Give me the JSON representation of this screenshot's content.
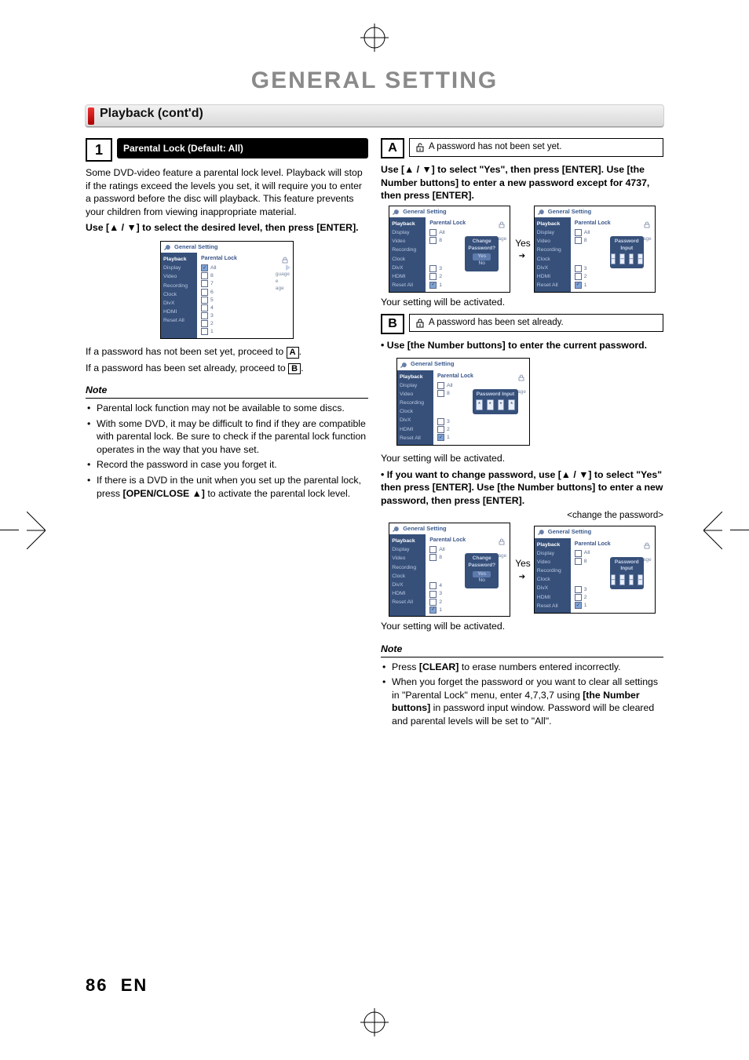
{
  "title": "GENERAL SETTING",
  "section": "Playback (cont'd)",
  "step1": {
    "num": "1",
    "heading": "Parental Lock (Default: All)",
    "para": "Some DVD-video feature a parental lock level. Playback will stop if the ratings exceed the levels you set, it will require you to enter a password before the disc will playback. This feature prevents your children from viewing inappropriate material.",
    "instr_pre": "Use [",
    "instr_mid": " / ",
    "instr_post": "] to select the desired level, then press [ENTER]."
  },
  "osd": {
    "title": "General Setting",
    "side": [
      "Playback",
      "Display",
      "Video",
      "Recording",
      "Clock",
      "DivX",
      "HDMI",
      "Reset All"
    ],
    "parental_label": "Parental Lock",
    "levels": [
      "All",
      "8",
      "7",
      "6",
      "5",
      "4",
      "3",
      "2",
      "1"
    ],
    "levels_short_top": [
      "All",
      "8"
    ],
    "levels_short_bottom": [
      "4",
      "3",
      "2",
      "1"
    ],
    "levels_short_bottom2": [
      "3",
      "2",
      "1"
    ],
    "side_labels_main": [
      "guage",
      "e",
      "age"
    ],
    "side_labels_small": "age",
    "change_pw": {
      "title": "Change Password?",
      "yes": "Yes",
      "no": "No"
    },
    "pw_input": "Password Input"
  },
  "proceedA": "If a password has not been set yet, proceed to",
  "proceedB": "If a password has been set already, proceed to",
  "note1": {
    "head": "Note",
    "items": [
      "Parental lock function may not be available to some discs.",
      "With some DVD, it may be difficult to find if they are compatible with parental lock. Be sure to check if the parental lock function operates in the way that you have set.",
      "Record the password in case you forget it.",
      "If there is a DVD in the unit when you set up the parental lock, press [OPEN/CLOSE ▲] to activate the parental lock level."
    ]
  },
  "A": {
    "label": "A",
    "text": "A password has not been set yet."
  },
  "B": {
    "label": "B",
    "text": "A password has been set already."
  },
  "right": {
    "instrA": "Use [▲ / ▼] to select \"Yes\", then press [ENTER]. Use [the Number buttons] to enter a new password except for 4737, then press [ENTER].",
    "activated": "Your setting will be activated.",
    "bulletB1": "Use [the Number buttons] to enter the current password.",
    "bulletB2": "If you want to change password, use [▲ / ▼] to select \"Yes\" then press [ENTER]. Use [the Number buttons] to enter a new password, then press [ENTER].",
    "changepw_caption": "<change the password>",
    "yes": "Yes"
  },
  "note2": {
    "head": "Note",
    "items": [
      "Press [CLEAR] to erase numbers entered incorrectly.",
      "When you forget the password or you want to clear all settings in \"Parental Lock\" menu, enter 4,7,3,7 using [the Number buttons] in password input window. Password will be cleared and parental levels will be set to \"All\"."
    ]
  },
  "page_num": "86",
  "page_lang": "EN"
}
